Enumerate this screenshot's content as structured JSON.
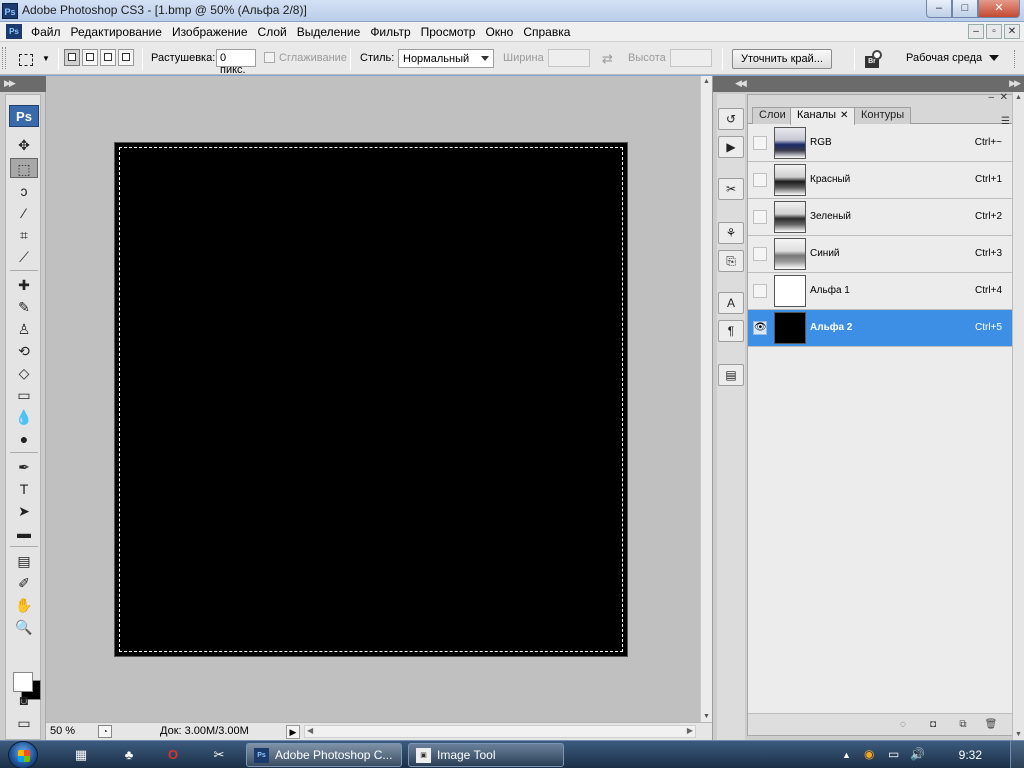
{
  "window": {
    "title": "Adobe Photoshop CS3 - [1.bmp @ 50% (Альфа 2/8)]",
    "app_icon": "Ps",
    "min_icon": "–",
    "max_icon": "□",
    "close_icon": "✕"
  },
  "menubar": {
    "items": [
      "Файл",
      "Редактирование",
      "Изображение",
      "Слой",
      "Выделение",
      "Фильтр",
      "Просмотр",
      "Окно",
      "Справка"
    ],
    "doc_min": "–",
    "doc_restore": "▫",
    "doc_close": "✕"
  },
  "options_bar": {
    "feather_label": "Растушевка:",
    "feather_value": "0 пикс.",
    "antialias_label": "Сглаживание",
    "style_label": "Стиль:",
    "style_value": "Нормальный",
    "width_label": "Ширина",
    "height_label": "Высота",
    "swap_icon": "⇄",
    "refine_edge_label": "Уточнить край...",
    "bridge_label": "Br",
    "workspace_label": "Рабочая среда"
  },
  "toolbox": {
    "logo": "Ps",
    "tools": [
      {
        "name": "move-tool",
        "glyph": "✥"
      },
      {
        "name": "rect-marquee-tool",
        "glyph": "⬚",
        "active": true
      },
      {
        "name": "lasso-tool",
        "glyph": "ↄ"
      },
      {
        "name": "magic-wand-tool",
        "glyph": "⁄"
      },
      {
        "name": "crop-tool",
        "glyph": "⌗"
      },
      {
        "name": "slice-tool",
        "glyph": "⟋"
      },
      {
        "name": "healing-brush-tool",
        "glyph": "✚"
      },
      {
        "name": "brush-tool",
        "glyph": "✎"
      },
      {
        "name": "clone-stamp-tool",
        "glyph": "♙"
      },
      {
        "name": "history-brush-tool",
        "glyph": "⟲"
      },
      {
        "name": "eraser-tool",
        "glyph": "◇"
      },
      {
        "name": "gradient-tool",
        "glyph": "▭"
      },
      {
        "name": "blur-tool",
        "glyph": "💧"
      },
      {
        "name": "dodge-tool",
        "glyph": "●"
      },
      {
        "name": "pen-tool",
        "glyph": "✒"
      },
      {
        "name": "type-tool",
        "glyph": "T"
      },
      {
        "name": "path-selection-tool",
        "glyph": "➤"
      },
      {
        "name": "rectangle-shape-tool",
        "glyph": "▬"
      },
      {
        "name": "notes-tool",
        "glyph": "▤"
      },
      {
        "name": "eyedropper-tool",
        "glyph": "✐"
      },
      {
        "name": "hand-tool",
        "glyph": "✋"
      },
      {
        "name": "zoom-tool",
        "glyph": "🔍"
      }
    ],
    "quick_mask_glyph": "◙",
    "screen_mode_glyph": "▭"
  },
  "status": {
    "zoom": "50 %",
    "doc_info": "Док: 3.00M/3.00M",
    "play_icon": "▶"
  },
  "panel": {
    "tabs": [
      {
        "label": "Слои",
        "active": false
      },
      {
        "label": "Каналы",
        "active": true,
        "close": "✕"
      },
      {
        "label": "Контуры",
        "active": false
      }
    ],
    "channels": [
      {
        "name": "RGB",
        "shortcut": "Ctrl+~",
        "thumb": "photo-rgb",
        "visible": false,
        "selected": false
      },
      {
        "name": "Красный",
        "shortcut": "Ctrl+1",
        "thumb": "photo-r",
        "visible": false,
        "selected": false
      },
      {
        "name": "Зеленый",
        "shortcut": "Ctrl+2",
        "thumb": "photo-g",
        "visible": false,
        "selected": false
      },
      {
        "name": "Синий",
        "shortcut": "Ctrl+3",
        "thumb": "photo-b",
        "visible": false,
        "selected": false
      },
      {
        "name": "Альфа 1",
        "shortcut": "Ctrl+4",
        "thumb": "white",
        "visible": false,
        "selected": false
      },
      {
        "name": "Альфа 2",
        "shortcut": "Ctrl+5",
        "thumb": "black",
        "visible": true,
        "selected": true
      }
    ],
    "eye_glyph": "👁",
    "footer": [
      "◌",
      "◘",
      "⧉",
      "🗑"
    ]
  },
  "dock_strip": [
    {
      "name": "history-panel-icon",
      "glyph": "↺"
    },
    {
      "name": "actions-panel-icon",
      "glyph": "▶"
    },
    {
      "name": "tool-presets-panel-icon",
      "glyph": "✂"
    },
    {
      "name": "brushes-panel-icon",
      "glyph": "⚘"
    },
    {
      "name": "clone-source-panel-icon",
      "glyph": "⎘"
    },
    {
      "name": "character-panel-icon",
      "glyph": "A"
    },
    {
      "name": "paragraph-panel-icon",
      "glyph": "¶"
    },
    {
      "name": "info-panel-icon",
      "glyph": "▤"
    }
  ],
  "taskbar": {
    "tasks": [
      {
        "label": "Adobe Photoshop C...",
        "icon": "Ps",
        "active": true
      },
      {
        "label": "Image Tool",
        "icon": "▣",
        "active": false
      }
    ],
    "clock": "9:32",
    "tray_icons": [
      "▲",
      "◉",
      "▭",
      "🔊"
    ]
  },
  "colors": {
    "selection_highlight": "#3d8fe6",
    "canvas_bg": "#c0c0c0",
    "document_fill": "#000000"
  }
}
